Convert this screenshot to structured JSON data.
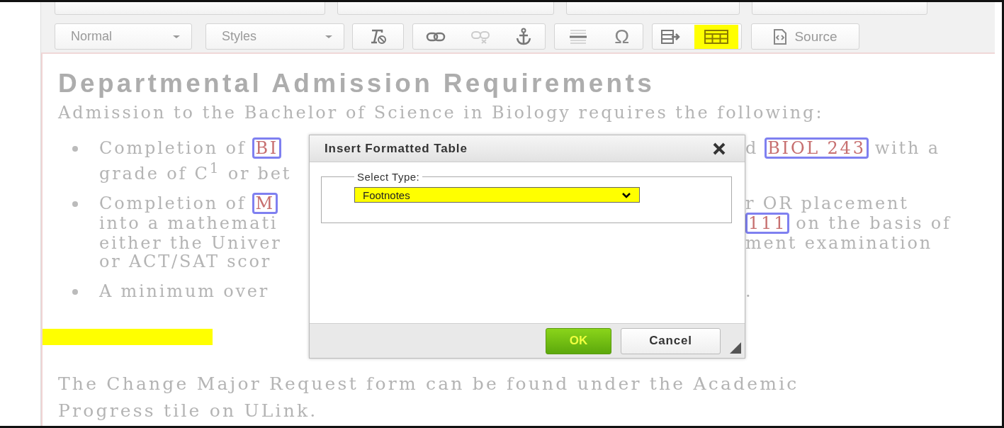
{
  "toolbar": {
    "format_combo": "Normal",
    "styles_combo": "Styles",
    "special_char": "Ω",
    "source_button": "Source",
    "table_button": {
      "highlighted": true
    }
  },
  "document": {
    "heading": "Departmental Admission Requirements",
    "intro": "Admission to the Bachelor of Science in Biology requires the following:",
    "bullets": [
      {
        "lines": [
          {
            "left": [
              {
                "kind": "plain",
                "text": "Completion of"
              },
              {
                "kind": "link",
                "text": "BI"
              }
            ],
            "right": [
              {
                "kind": "plain",
                "text": "d"
              },
              {
                "kind": "link",
                "text": "BIOL 243"
              },
              {
                "kind": "plain",
                "text": "with a"
              }
            ]
          },
          {
            "left": [
              {
                "kind": "plain",
                "text": "grade of C$^{1}$ or bet"
              }
            ]
          }
        ]
      },
      {
        "lines": [
          {
            "left": [
              {
                "kind": "plain",
                "text": "Completion of"
              },
              {
                "kind": "link",
                "text": "M"
              }
            ],
            "right": [
              {
                "kind": "plain",
                "text": "r OR placement"
              }
            ]
          },
          {
            "left": [
              {
                "kind": "plain",
                "text": "into a mathemati"
              }
            ],
            "right": [
              {
                "kind": "link",
                "text": "111"
              },
              {
                "kind": "plain",
                "text": "on the basis of"
              }
            ]
          },
          {
            "left": [
              {
                "kind": "plain",
                "text": "either the Univer"
              }
            ],
            "right": [
              {
                "kind": "plain",
                "text": "ment examination"
              }
            ]
          },
          {
            "left": [
              {
                "kind": "plain",
                "text": "or ACT/SAT scor"
              }
            ]
          }
        ]
      },
      {
        "lines": [
          {
            "left": [
              {
                "kind": "plain",
                "text": "A minimum over"
              }
            ],
            "right": [
              {
                "kind": "plain",
                "text": "."
              }
            ]
          }
        ]
      }
    ],
    "highlight_mark": {
      "highlighted": true
    },
    "closing_lines": [
      "The Change Major Request form can be found under the Academic",
      "Progress tile on ULink."
    ]
  },
  "dialog": {
    "title": "Insert Formatted Table",
    "legend": "Select Type:",
    "select": {
      "value": "Footnotes",
      "highlighted": true
    },
    "ok": "OK",
    "cancel": "Cancel"
  }
}
